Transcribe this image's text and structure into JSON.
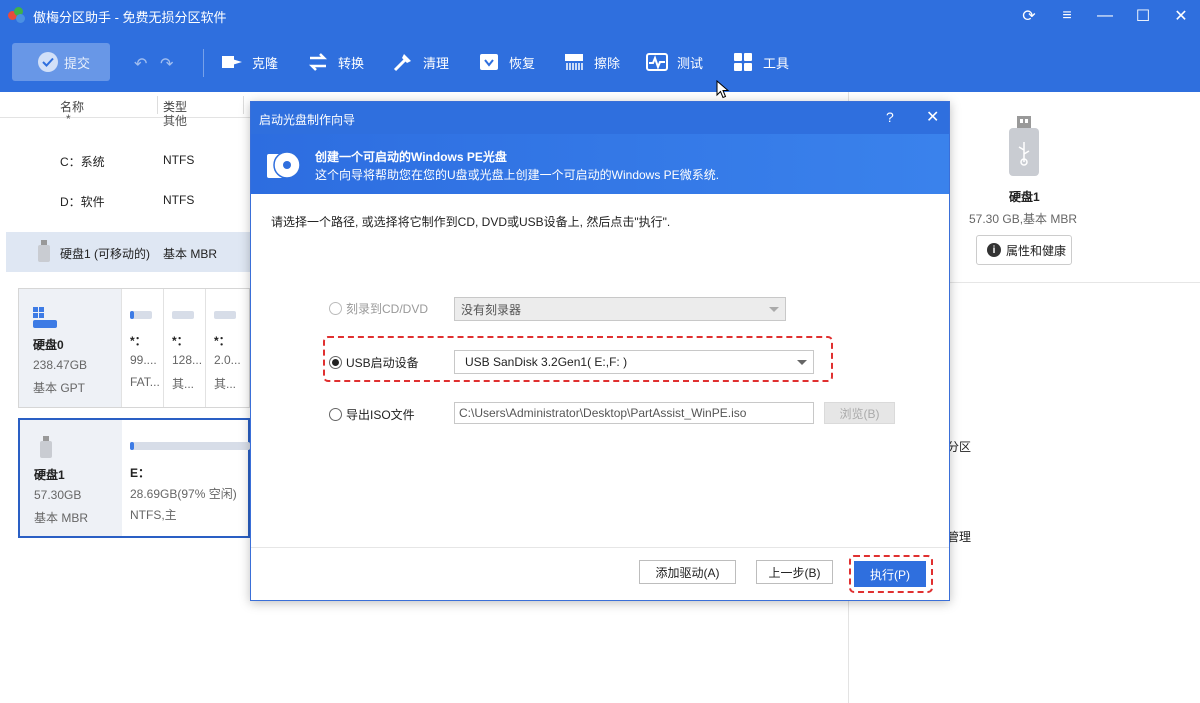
{
  "app": {
    "title": "傲梅分区助手 - 免费无损分区软件",
    "brand_color": "#2f6fde"
  },
  "window_buttons": [
    "refresh-icon",
    "menu-icon",
    "minimize-icon",
    "maximize-icon",
    "close-icon"
  ],
  "toolbar": {
    "submit_label": "提交",
    "items": [
      {
        "label": "克隆",
        "icon": "clone-icon"
      },
      {
        "label": "转换",
        "icon": "convert-icon"
      },
      {
        "label": "清理",
        "icon": "clean-icon"
      },
      {
        "label": "恢复",
        "icon": "recover-icon"
      },
      {
        "label": "擦除",
        "icon": "wipe-icon"
      },
      {
        "label": "测试",
        "icon": "test-icon"
      },
      {
        "label": "工具",
        "icon": "tools-icon"
      }
    ]
  },
  "table": {
    "headers": [
      "名称",
      "类型"
    ],
    "rows": [
      {
        "name": "*",
        "type": "其他"
      },
      {
        "name": "C：系统",
        "type": "NTFS"
      },
      {
        "name": "D：软件",
        "type": "NTFS"
      },
      {
        "name": "硬盘1 (可移动的)",
        "type": "基本 MBR"
      }
    ]
  },
  "disks": [
    {
      "name": "硬盘0",
      "size": "238.47GB",
      "type": "基本 GPT",
      "partitions": [
        {
          "label": "*：",
          "size": "99....",
          "fs": "FAT..."
        },
        {
          "label": "*：",
          "size": "128...",
          "fs": "其..."
        },
        {
          "label": "*：",
          "size": "2.0...",
          "fs": "其..."
        }
      ]
    },
    {
      "name": "硬盘1",
      "size": "57.30GB",
      "type": "基本 MBR",
      "partitions": [
        {
          "label": "E：",
          "size": "28.69GB(97% 空闲)",
          "fs": "NTFS,主",
          "used_fraction": 0.03
        }
      ]
    }
  ],
  "right_panel": {
    "disk_name": "硬盘1",
    "disk_sub": "57.30 GB,基本 MBR",
    "props_button": "属性和健康",
    "frag1": "分区",
    "frag2": "管理"
  },
  "dialog": {
    "title": "启动光盘制作向导",
    "help": "?",
    "close": "✕",
    "banner_title": "创建一个可启动的Windows PE光盘",
    "banner_desc": "这个向导将帮助您在您的U盘或光盘上创建一个可启动的Windows PE微系统.",
    "instruction": "请选择一个路径, 或选择将它制作到CD, DVD或USB设备上, 然后点击\"执行\".",
    "options": {
      "cd": {
        "label": "刻录到CD/DVD",
        "value": "没有刻录器",
        "enabled": false,
        "selected": false
      },
      "usb": {
        "label": "USB启动设备",
        "value": "USB SanDisk 3.2Gen1( E:,F: )",
        "enabled": true,
        "selected": true
      },
      "iso": {
        "label": "导出ISO文件",
        "value": "C:\\Users\\Administrator\\Desktop\\PartAssist_WinPE.iso",
        "browse": "浏览(B)",
        "selected": false
      }
    },
    "buttons": {
      "add_driver": "添加驱动(A)",
      "back": "上一步(B)",
      "execute": "执行(P)"
    },
    "highlight_color": "#e03030"
  }
}
